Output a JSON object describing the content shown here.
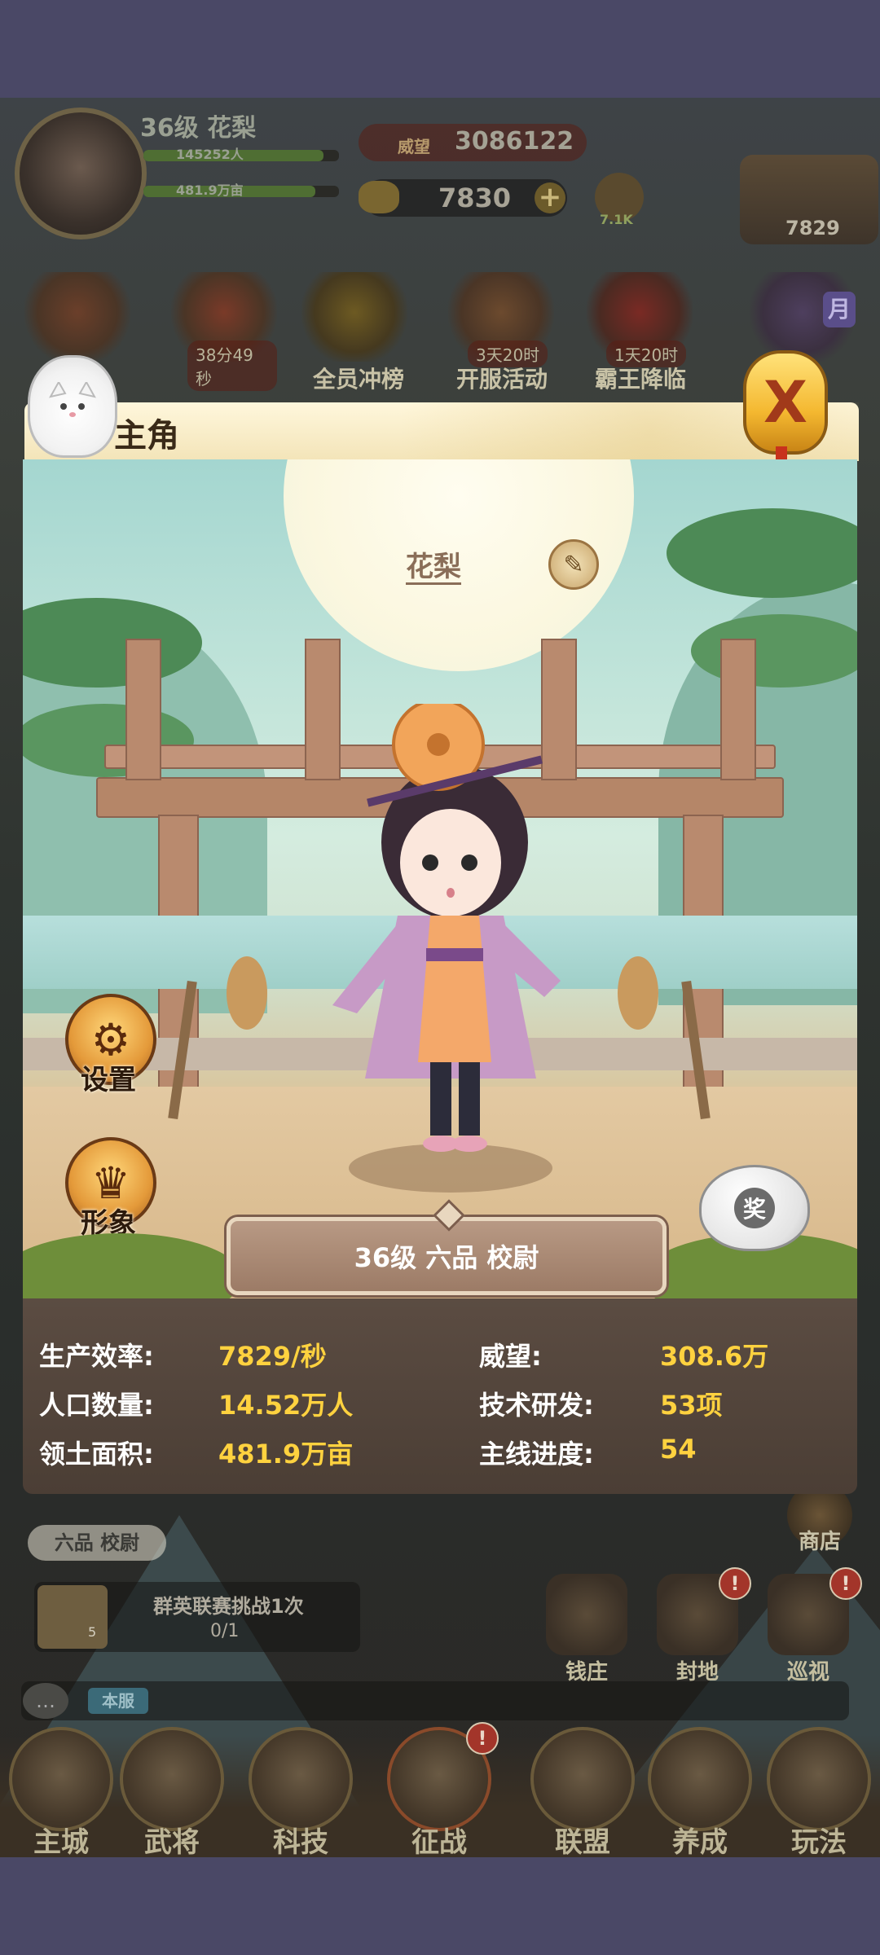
{
  "player": {
    "level_name": "36级 花梨",
    "population_value": "145252人",
    "territory_value": "481.9万亩",
    "prestige_label": "威望",
    "prestige_value": "3086122",
    "gold_value": "7830",
    "side_small_value": "7.1K",
    "income_value": "7829"
  },
  "events": [
    {
      "label": "",
      "timer": ""
    },
    {
      "label": "",
      "timer": "38分49秒"
    },
    {
      "label": "全员冲榜",
      "timer": ""
    },
    {
      "label": "开服活动",
      "timer": "3天20时"
    },
    {
      "label": "霸王降临",
      "timer": "1天20时"
    },
    {
      "label": "",
      "timer": ""
    }
  ],
  "event_month_char": "月",
  "modal": {
    "title": "主角",
    "character_name": "花梨",
    "settings_label": "设置",
    "appearance_label": "形象",
    "rank_text": "36级 六品 校尉",
    "reward_char": "奖",
    "close_char": "X"
  },
  "stats": [
    {
      "label": "生产效率:",
      "value": "7829/秒"
    },
    {
      "label": "威望:",
      "value": "308.6万"
    },
    {
      "label": "人口数量:",
      "value": "14.52万人"
    },
    {
      "label": "技术研发:",
      "value": "53项"
    },
    {
      "label": "领土面积:",
      "value": "481.9万亩"
    },
    {
      "label": "主线进度:",
      "value": "54"
    }
  ],
  "lower": {
    "rank_badge": "六品 校尉",
    "quest_title": "群英联赛挑战1次",
    "quest_progress": "0/1",
    "quest_item_count": "5",
    "chat_channel": "本服",
    "shop_label": "商店",
    "side_buttons": [
      {
        "label": "钱庄",
        "badge": ""
      },
      {
        "label": "封地",
        "badge": "!"
      },
      {
        "label": "巡视",
        "badge": "!"
      }
    ]
  },
  "bottom_nav": [
    {
      "label": "主城",
      "badge": ""
    },
    {
      "label": "武将",
      "badge": ""
    },
    {
      "label": "科技",
      "badge": ""
    },
    {
      "label": "征战",
      "badge": "!"
    },
    {
      "label": "联盟",
      "badge": ""
    },
    {
      "label": "养成",
      "badge": ""
    },
    {
      "label": "玩法",
      "badge": ""
    }
  ]
}
